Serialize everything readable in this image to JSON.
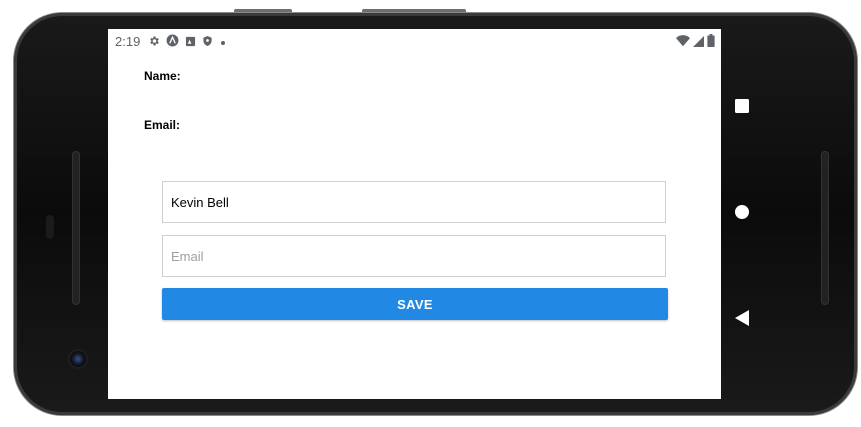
{
  "statusbar": {
    "time": "2:19",
    "left_icons": [
      "settings-gear-icon",
      "app-a-icon",
      "app-image-icon",
      "shield-icon",
      "dot-icon"
    ],
    "right_icons": [
      "wifi-icon",
      "signal-icon",
      "battery-icon"
    ]
  },
  "form": {
    "name_label": "Name:",
    "email_label": "Email:",
    "name_value": "Kevin Bell",
    "name_placeholder": "",
    "email_value": "",
    "email_placeholder": "Email",
    "save_label": "SAVE",
    "accent_color": "#2189e3"
  },
  "navbar": {
    "buttons": [
      "recent-apps",
      "home",
      "back"
    ]
  }
}
